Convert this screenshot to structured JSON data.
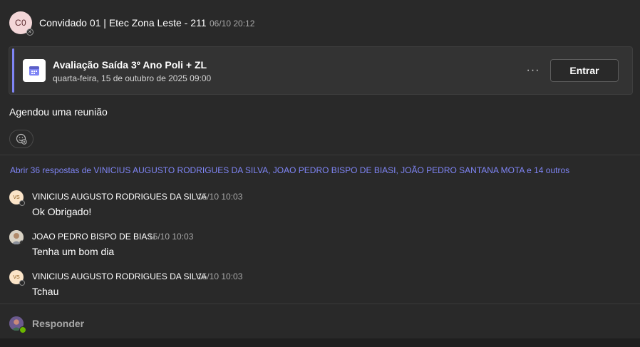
{
  "post": {
    "avatar_initials": "C0",
    "author": "Convidado 01 | Etec Zona Leste - 211",
    "timestamp": "06/10 20:12",
    "body": "Agendou uma reunião"
  },
  "meeting_card": {
    "icon": "calendar-icon",
    "title": "Avaliação Saída 3º Ano Poli + ZL",
    "subtitle": "quarta-feira, 15 de outubro de 2025 09:00",
    "more_label": "···",
    "join_label": "Entrar",
    "accent_color": "#7f85f5"
  },
  "thread": {
    "open_replies": "Abrir 36 respostas de VINICIUS AUGUSTO RODRIGUES DA SILVA, JOAO PEDRO BISPO DE BIASI, JOÃO PEDRO SANTANA MOTA e 14 outros",
    "replies": [
      {
        "avatar": "VS",
        "author": "VINICIUS AUGUSTO RODRIGUES DA SILVA",
        "time": "15/10 10:03",
        "text": "Ok Obrigado!"
      },
      {
        "avatar": "",
        "author": "JOAO PEDRO BISPO DE BIASI",
        "time": "15/10 10:03",
        "text": "Tenha um bom dia"
      },
      {
        "avatar": "VS",
        "author": "VINICIUS AUGUSTO RODRIGUES DA SILVA",
        "time": "15/10 10:03",
        "text": "Tchau"
      }
    ]
  },
  "reply_box": {
    "label": "Responder"
  },
  "colors": {
    "background": "#292929",
    "link": "#7f85f5",
    "presence_available": "#6bb700"
  }
}
